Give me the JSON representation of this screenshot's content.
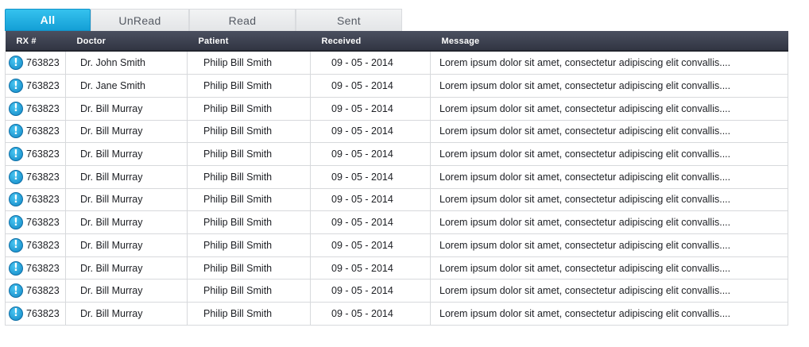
{
  "tabs": [
    {
      "label": "All",
      "active": true
    },
    {
      "label": "UnRead",
      "active": false
    },
    {
      "label": "Read",
      "active": false
    },
    {
      "label": "Sent",
      "active": false
    }
  ],
  "table": {
    "columns": [
      "RX #",
      "Doctor",
      "Patient",
      "Received",
      "Message"
    ],
    "row_icon": "alert-exclamation-icon",
    "rows": [
      {
        "rx": "763823",
        "doctor": "Dr. John Smith",
        "patient": "Philip Bill Smith",
        "received": "09 - 05 - 2014",
        "message": "Lorem ipsum dolor sit amet, consectetur adipiscing elit convallis...."
      },
      {
        "rx": "763823",
        "doctor": "Dr. Jane Smith",
        "patient": "Philip Bill Smith",
        "received": "09 - 05 - 2014",
        "message": "Lorem ipsum dolor sit amet, consectetur adipiscing elit convallis...."
      },
      {
        "rx": "763823",
        "doctor": "Dr. Bill Murray",
        "patient": "Philip Bill Smith",
        "received": "09 - 05 - 2014",
        "message": "Lorem ipsum dolor sit amet, consectetur adipiscing elit convallis...."
      },
      {
        "rx": "763823",
        "doctor": "Dr. Bill Murray",
        "patient": "Philip Bill Smith",
        "received": "09 - 05 - 2014",
        "message": "Lorem ipsum dolor sit amet, consectetur adipiscing elit convallis...."
      },
      {
        "rx": "763823",
        "doctor": "Dr. Bill Murray",
        "patient": "Philip Bill Smith",
        "received": "09 - 05 - 2014",
        "message": "Lorem ipsum dolor sit amet, consectetur adipiscing elit convallis...."
      },
      {
        "rx": "763823",
        "doctor": "Dr. Bill Murray",
        "patient": "Philip Bill Smith",
        "received": "09 - 05 - 2014",
        "message": "Lorem ipsum dolor sit amet, consectetur adipiscing elit convallis...."
      },
      {
        "rx": "763823",
        "doctor": "Dr. Bill Murray",
        "patient": "Philip Bill Smith",
        "received": "09 - 05 - 2014",
        "message": "Lorem ipsum dolor sit amet, consectetur adipiscing elit convallis...."
      },
      {
        "rx": "763823",
        "doctor": "Dr. Bill Murray",
        "patient": "Philip Bill Smith",
        "received": "09 - 05 - 2014",
        "message": "Lorem ipsum dolor sit amet, consectetur adipiscing elit convallis...."
      },
      {
        "rx": "763823",
        "doctor": "Dr. Bill Murray",
        "patient": "Philip Bill Smith",
        "received": "09 - 05 - 2014",
        "message": "Lorem ipsum dolor sit amet, consectetur adipiscing elit convallis...."
      },
      {
        "rx": "763823",
        "doctor": "Dr. Bill Murray",
        "patient": "Philip Bill Smith",
        "received": "09 - 05 - 2014",
        "message": "Lorem ipsum dolor sit amet, consectetur adipiscing elit convallis...."
      },
      {
        "rx": "763823",
        "doctor": "Dr. Bill Murray",
        "patient": "Philip Bill Smith",
        "received": "09 - 05 - 2014",
        "message": "Lorem ipsum dolor sit amet, consectetur adipiscing elit convallis...."
      },
      {
        "rx": "763823",
        "doctor": "Dr. Bill Murray",
        "patient": "Philip Bill Smith",
        "received": "09 - 05 - 2014",
        "message": "Lorem ipsum dolor sit amet, consectetur adipiscing elit convallis...."
      }
    ]
  },
  "colors": {
    "active_tab": "#1ea9df",
    "header_bg": "#3a3e4b",
    "icon": "#1a8fd0"
  }
}
